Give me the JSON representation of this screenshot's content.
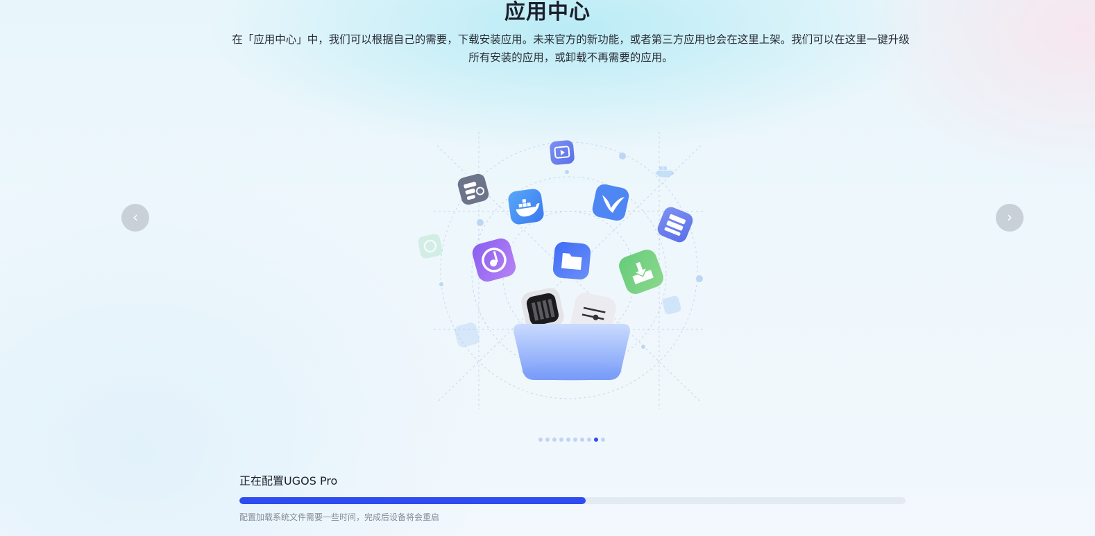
{
  "header": {
    "title": "应用中心",
    "description": "在「应用中心」中，我们可以根据自己的需要，下载安装应用。未来官方的新功能，或者第三方应用也会在这里上架。我们可以在这里一键升级所有安装的应用，或卸载不再需要的应用。"
  },
  "carousel": {
    "prev_symbol": "‹",
    "next_symbol": "›",
    "slide_count": 10,
    "active_index": 8,
    "icons": [
      "video-icon",
      "search-server-icon",
      "docker-icon",
      "bird-icon",
      "storage-icon",
      "music-icon",
      "folder-icon",
      "download-icon",
      "nas-icon",
      "equalizer-icon",
      "sync-icon",
      "whale-icon",
      "image-icon",
      "chart-icon"
    ]
  },
  "progress": {
    "label": "正在配置UGOS Pro",
    "percent": 52,
    "note": "配置加载系统文件需要一些时间，完成后设备将会重启"
  },
  "colors": {
    "accent": "#2e4cf2",
    "track": "#e3eaf1",
    "dot_inactive": "#c3d2f5"
  }
}
